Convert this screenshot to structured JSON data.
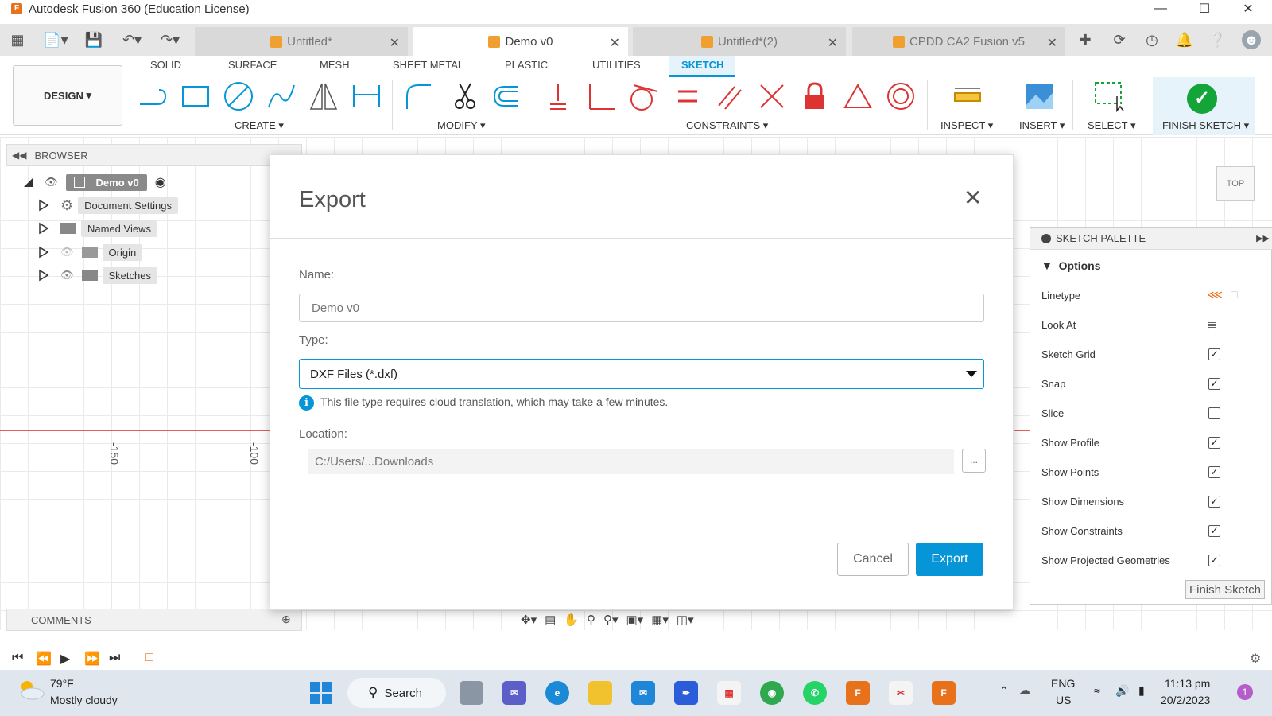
{
  "window": {
    "title": "Autodesk Fusion 360 (Education License)",
    "logo_letter": "F"
  },
  "doc_tabs": [
    {
      "label": "Untitled*",
      "active": false
    },
    {
      "label": "Demo v0",
      "active": true
    },
    {
      "label": "Untitled*(2)",
      "active": false
    },
    {
      "label": "CPDD CA2 Fusion v5",
      "active": false
    }
  ],
  "ribbon": {
    "workspace": "DESIGN",
    "tabs": [
      "SOLID",
      "SURFACE",
      "MESH",
      "SHEET METAL",
      "PLASTIC",
      "UTILITIES",
      "SKETCH"
    ],
    "active_tab": "SKETCH",
    "groups": {
      "create": "CREATE",
      "modify": "MODIFY",
      "constraints": "CONSTRAINTS",
      "inspect": "INSPECT",
      "insert": "INSERT",
      "select": "SELECT",
      "finish": "FINISH SKETCH"
    }
  },
  "browser": {
    "header": "BROWSER",
    "root": "Demo v0",
    "items": [
      "Document Settings",
      "Named Views",
      "Origin",
      "Sketches"
    ]
  },
  "comments": {
    "label": "COMMENTS"
  },
  "canvas": {
    "axis_labels": [
      "-150",
      "-100"
    ],
    "view_cube_label": "TOP"
  },
  "sketch_palette": {
    "title": "SKETCH PALETTE",
    "section": "Options",
    "rows": [
      {
        "label": "Linetype",
        "kind": "icons"
      },
      {
        "label": "Look At",
        "kind": "icon"
      },
      {
        "label": "Sketch Grid",
        "kind": "checkbox",
        "checked": true
      },
      {
        "label": "Snap",
        "kind": "checkbox",
        "checked": true
      },
      {
        "label": "Slice",
        "kind": "checkbox",
        "checked": false
      },
      {
        "label": "Show Profile",
        "kind": "checkbox",
        "checked": true
      },
      {
        "label": "Show Points",
        "kind": "checkbox",
        "checked": true
      },
      {
        "label": "Show Dimensions",
        "kind": "checkbox",
        "checked": true
      },
      {
        "label": "Show Constraints",
        "kind": "checkbox",
        "checked": true
      },
      {
        "label": "Show Projected Geometries",
        "kind": "checkbox",
        "checked": true
      }
    ],
    "finish_button": "Finish Sketch"
  },
  "export_dialog": {
    "title": "Export",
    "name_label": "Name:",
    "name_value": "Demo v0",
    "type_label": "Type:",
    "type_value": "DXF Files (*.dxf)",
    "info_text": "This file type requires cloud translation, which may take a few minutes.",
    "location_label": "Location:",
    "location_value": "C:/Users/...Downloads",
    "browse_label": "...",
    "cancel_label": "Cancel",
    "export_label": "Export"
  },
  "taskbar": {
    "temperature": "79°F",
    "weather": "Mostly cloudy",
    "search_label": "Search",
    "lang_line1": "ENG",
    "lang_line2": "US",
    "time": "11:13 pm",
    "date": "20/2/2023",
    "notification_count": "1"
  },
  "colors": {
    "accent": "#0696d7",
    "finish_green": "#13a538",
    "fusion_orange": "#e8711c"
  }
}
